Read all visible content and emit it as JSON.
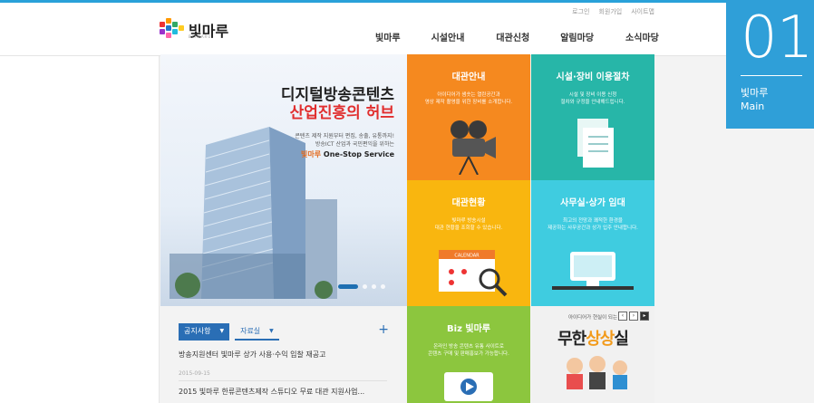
{
  "header": {
    "logo_text": "빛마루",
    "logo_sub": "BITMARU",
    "util_links": [
      "로그인",
      "회원가입",
      "사이트맵"
    ],
    "gnb": [
      "빛마루",
      "시설안내",
      "대관신청",
      "알림마당",
      "소식마당"
    ]
  },
  "badge": {
    "number": "01",
    "line1": "빛마루",
    "line2": "Main"
  },
  "hero": {
    "title_line1": "디지털방송콘텐츠",
    "title_line2": "산업진흥의 허브",
    "desc_line1": "콘텐츠 제작 지원부터 편집, 송출, 유통까지!",
    "desc_line2": "방송ICT 산업과 국민편익을 위하는",
    "one_stop_brand": "빛마루",
    "one_stop": "One-Stop Service"
  },
  "tiles": {
    "t1": {
      "title": "대관안내",
      "desc1": "아이디어가 샘솟는 열린공간과",
      "desc2": "영상 제작 촬영을 위한 장비를 소개합니다."
    },
    "t2": {
      "title": "시설·장비 이용절차",
      "desc1": "시설 및 장비 이용 신청",
      "desc2": "절차와 규정을 안내해드립니다."
    },
    "t3": {
      "title": "대관현황",
      "desc1": "빛마루 방송시설",
      "desc2": "대관 현황을 조회할 수 있습니다.",
      "calendar": "CALENDAR"
    },
    "t4": {
      "title": "사무실·상가 임대",
      "desc1": "최고의 전망과 쾌적한 환경을",
      "desc2": "제공하는 사무공간과 상가 입주 안내합니다."
    },
    "t5": {
      "title": "Biz 빛마루",
      "desc1": "온라인 방송 콘텐츠 유통 사이트로",
      "desc2": "콘텐츠 구매 및 판매홍보가 가능합니다."
    },
    "t6": {
      "top": "아이디어가 현실이 되는",
      "big_pre": "무한",
      "big_acc": "상상",
      "big_post": "실"
    }
  },
  "notice": {
    "tab_active": "공지사항",
    "tab_inactive": "자료실",
    "items": [
      {
        "title": "방송지원센터 빛마루 상가 사용·수익 입찰 재공고",
        "date": "2015-09-15"
      },
      {
        "title": "2015 빛마루 한류콘텐츠제작 스튜디오 무료 대관 지원사업...",
        "date": ""
      }
    ]
  }
}
